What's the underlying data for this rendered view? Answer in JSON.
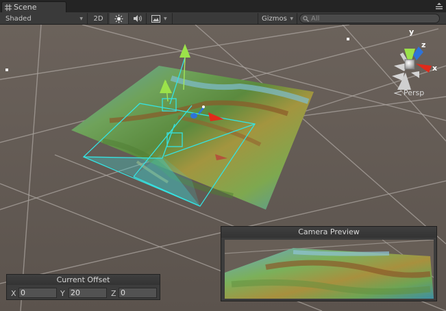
{
  "tab": {
    "label": "Scene",
    "icon": "scene-grid-icon"
  },
  "toolbar": {
    "shading_mode": "Shaded",
    "mode_2d": "2D",
    "lighting_icon": "sun-icon",
    "audio_icon": "speaker-icon",
    "effects_icon": "image-icon",
    "gizmos_label": "Gizmos",
    "search_placeholder": "All"
  },
  "viewport": {
    "projection_label": "Persp",
    "orientation_gizmo": {
      "axis_y": "y",
      "axis_z": "z",
      "axis_x": "x"
    },
    "colors": {
      "background": "#635a54",
      "grid_line": "#a9a39d",
      "frustum": "#35e3e3",
      "axis_y": "#9be24a",
      "axis_x": "#e02a1a",
      "axis_z": "#2e73d8"
    }
  },
  "current_offset": {
    "title": "Current Offset",
    "x_label": "X",
    "x_value": "0",
    "y_label": "Y",
    "y_value": "20",
    "z_label": "Z",
    "z_value": "0"
  },
  "camera_preview": {
    "title": "Camera Preview"
  }
}
